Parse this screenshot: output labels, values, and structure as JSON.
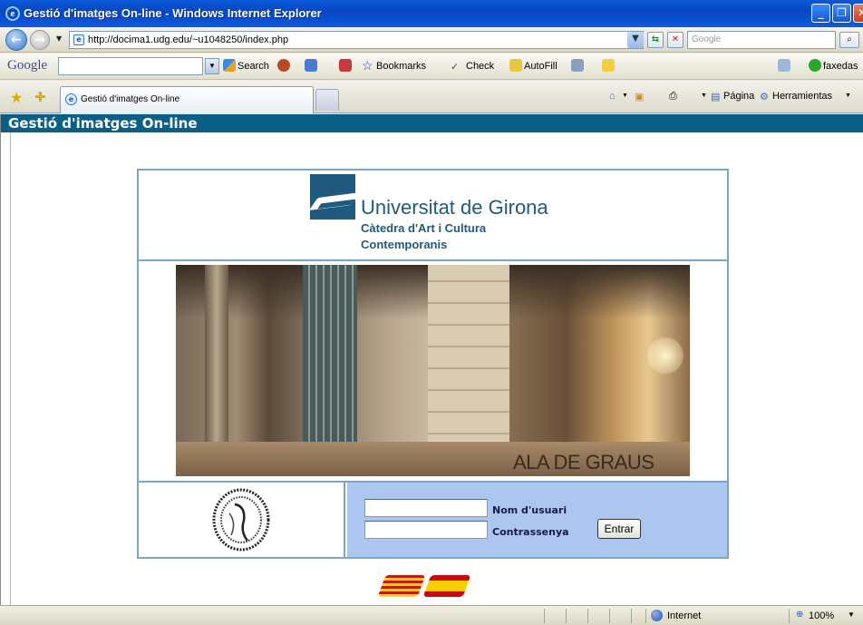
{
  "window": {
    "title": "Gestió d'imatges On-line - Windows Internet Explorer"
  },
  "address_bar": {
    "url": "http://docima1.udg.edu/~u1048250/index.php",
    "search_placeholder": "Google"
  },
  "google_toolbar": {
    "logo": "Google",
    "search_label": "Search",
    "bookmarks_label": "Bookmarks",
    "check_label": "Check",
    "autofill_label": "AutoFill",
    "user_label": "faxedas"
  },
  "tabs": {
    "active_title": "Gestió d'imatges On-line"
  },
  "command_bar": {
    "page_label": "Página",
    "tools_label": "Herramientas"
  },
  "page": {
    "header_title": "Gestió d'imatges On-line",
    "logo": {
      "name": "Universitat de Girona",
      "line1": "Càtedra d'Art i Cultura",
      "line2": "Contemporanis"
    },
    "photo_caption": "ALA DE GRAUS",
    "login": {
      "username_label": "Nom d'usuari",
      "password_label": "Contrassenya",
      "username_value": "",
      "password_value": "",
      "submit_label": "Entrar"
    }
  },
  "status_bar": {
    "zone": "Internet",
    "zoom": "100%"
  }
}
